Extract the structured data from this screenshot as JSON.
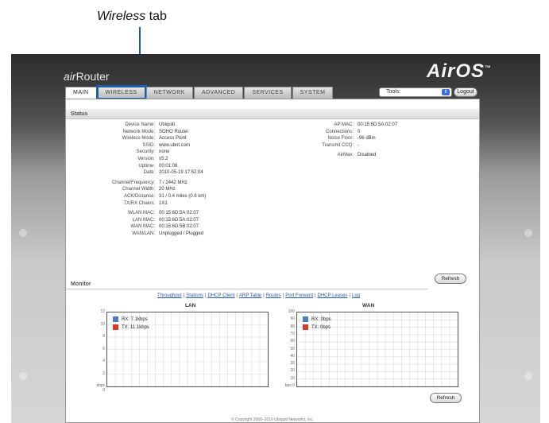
{
  "annotation": {
    "label": "Wireless",
    "suffix": " tab"
  },
  "brand": {
    "left": "air",
    "left2": "Router",
    "right": "AirOS",
    "tm": "™"
  },
  "tabs": [
    {
      "label": "MAIN"
    },
    {
      "label": "WIRELESS"
    },
    {
      "label": "NETWORK"
    },
    {
      "label": "ADVANCED"
    },
    {
      "label": "SERVICES"
    },
    {
      "label": "SYSTEM"
    }
  ],
  "toolbar": {
    "tools_label": "Tools:",
    "tools_arrow": "⇕",
    "logout_label": "Logout"
  },
  "status": {
    "title": "Status",
    "left": [
      {
        "k": "Device Name:",
        "v": "Ubiquiti"
      },
      {
        "k": "Network Mode:",
        "v": "SOHO Router"
      },
      {
        "k": "Wireless Mode:",
        "v": "Access Point"
      },
      {
        "k": "SSID:",
        "v": "www.ubnt.com"
      },
      {
        "k": "Security:",
        "v": "none"
      },
      {
        "k": "Version:",
        "v": "v5.2"
      },
      {
        "k": "Uptime:",
        "v": "00:01:06"
      },
      {
        "k": "Date:",
        "v": "2010-05-19 17:52:04"
      },
      {
        "k": "Channel/Frequency:",
        "v": "7 / 2442 MHz"
      },
      {
        "k": "Channel Width:",
        "v": "20 MHz"
      },
      {
        "k": "ACK/Distance:",
        "v": "31 / 0.4 miles (0.6 km)"
      },
      {
        "k": "TX/RX Chains:",
        "v": "1X1"
      },
      {
        "k": "WLAN MAC:",
        "v": "00:15:6D:5A:02:07"
      },
      {
        "k": "LAN MAC:",
        "v": "00:15:6D:5A:02:07"
      },
      {
        "k": "WAN MAC:",
        "v": "00:15:6D:5B:02:07"
      },
      {
        "k": "WAN/LAN:",
        "v": "Unplugged / Plugged"
      }
    ],
    "right": [
      {
        "k": "AP MAC:",
        "v": "00:15:6D:5A:02:07"
      },
      {
        "k": "Connections:",
        "v": "0"
      },
      {
        "k": "Noise Floor:",
        "v": "-96 dBm"
      },
      {
        "k": "Transmit CCQ:",
        "v": "-"
      },
      {
        "k": "AirMax:",
        "v": "Disabled"
      }
    ],
    "refresh_label": "Refresh"
  },
  "monitor": {
    "title": "Monitor",
    "links": [
      "Throughput",
      "Stations",
      "DHCP Client",
      "ARP Table",
      "Routes",
      "Port Forward",
      "DHCP Leases",
      "Log"
    ],
    "lan": {
      "title": "LAN",
      "yticks": [
        "12",
        "10",
        "8",
        "6",
        "4",
        "2",
        "kbps 0"
      ],
      "rx": "RX: 7.1kbps",
      "tx": "TX: 11.1kbps"
    },
    "wan": {
      "title": "WAN",
      "yticks": [
        "100",
        "90",
        "80",
        "70",
        "60",
        "50",
        "40",
        "30",
        "20",
        "10",
        "bps 0"
      ],
      "rx": "RX: 0bps",
      "tx": "TX: 0bps"
    },
    "refresh_label": "Refresh"
  },
  "footer": "© Copyright 2006–2010 Ubiquiti Networks, Inc.",
  "colors": {
    "rx": "#4a7fc1",
    "tx": "#d23a2a",
    "highlight": "#1a5fa8"
  }
}
